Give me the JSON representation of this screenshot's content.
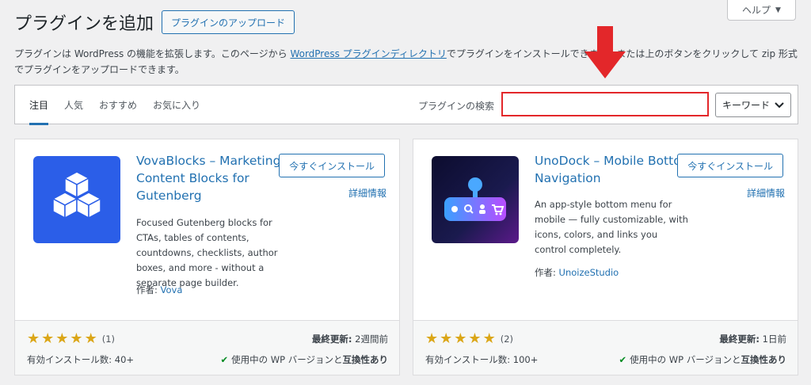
{
  "header": {
    "title": "プラグインを追加",
    "upload_label": "プラグインのアップロード",
    "help_label": "ヘルプ"
  },
  "intro": {
    "text_before": "プラグインは WordPress の機能を拡張します。このページから ",
    "link": "WordPress プラグインディレクトリ",
    "text_after": "でプラグインをインストールできます。または上のボタンをクリックして zip 形式でプラグインをアップロードできます。"
  },
  "filter": {
    "tabs": [
      {
        "label": "注目"
      },
      {
        "label": "人気"
      },
      {
        "label": "おすすめ"
      },
      {
        "label": "お気に入り"
      }
    ],
    "search_label": "プラグインの検索",
    "search_value": "",
    "search_type": "キーワード"
  },
  "plugins": [
    {
      "name": "VovaBlocks – Marketing & Content Blocks for Gutenberg",
      "install_label": "今すぐインストール",
      "details_label": "詳細情報",
      "description": "Focused Gutenberg blocks for CTAs, tables of contents, countdowns, checklists, author boxes, and more - without a separate page builder.",
      "author_prefix": "作者: ",
      "author": "Vova",
      "rating_count": "(1)",
      "installs": "有効インストール数: 40+",
      "updated_label": "最終更新:",
      "updated": " 2週間前",
      "compat_prefix": "使用中の WP バージョンと",
      "compat_bold": "互換性あり",
      "icon": "cubes-icon",
      "icon_color": "#2b5ee8"
    },
    {
      "name": "UnoDock – Mobile Bottom Navigation",
      "install_label": "今すぐインストール",
      "details_label": "詳細情報",
      "description": "An app-style bottom menu for mobile — fully customizable, with icons, colors, and links you control completely.",
      "author_prefix": "作者: ",
      "author": "UnoizeStudio",
      "rating_count": "(2)",
      "installs": "有効インストール数: 100+",
      "updated_label": "最終更新:",
      "updated": " 1日前",
      "compat_prefix": "使用中の WP バージョンと",
      "compat_bold": "互換性あり",
      "icon": "mobile-navbar-icon",
      "icon_color": "#1a1a4e"
    }
  ],
  "annotation": {
    "arrow_color": "#e3272a",
    "highlight_color": "#e3272a"
  }
}
